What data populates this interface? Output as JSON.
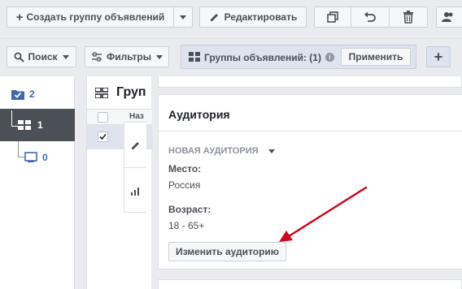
{
  "toolbar": {
    "create_label": "Создать группу объявлений",
    "edit_label": "Редактировать"
  },
  "filters": {
    "search_label": "Поиск",
    "filters_label": "Фильтры",
    "adsets_label": "Группы объявлений: (1)",
    "apply_label": "Применить"
  },
  "tree": {
    "items": [
      {
        "count": "2"
      },
      {
        "count": "1"
      },
      {
        "count": "0"
      }
    ]
  },
  "table": {
    "title": "Груп",
    "column_header": "Наз"
  },
  "audience": {
    "title": "Аудитория",
    "new_audience_label": "НОВАЯ АУДИТОРИЯ",
    "location_label": "Место:",
    "location_value": "Россия",
    "age_label": "Возраст:",
    "age_value": "18 - 65+",
    "change_button_label": "Изменить аудиторию"
  },
  "colors": {
    "accent": "#4267b2",
    "arrow": "#d0021b",
    "selected_row": "#4b4f56"
  }
}
